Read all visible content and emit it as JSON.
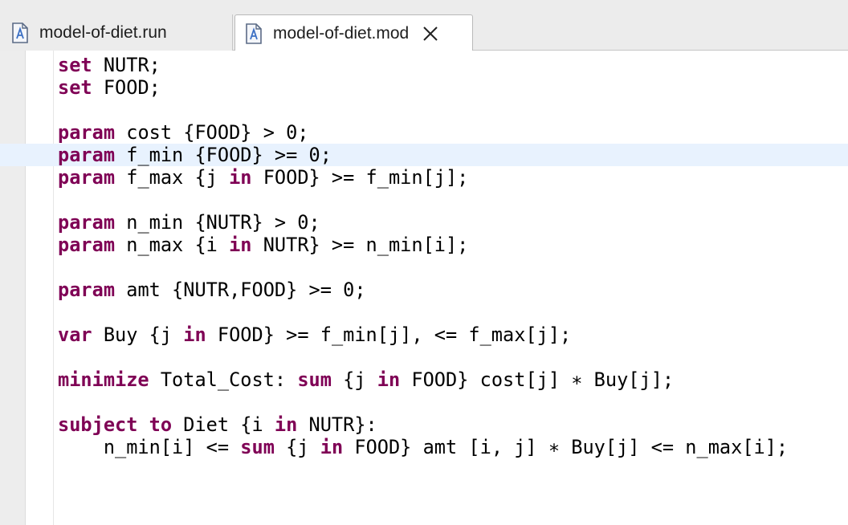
{
  "tabs": [
    {
      "label": "model-of-diet.run",
      "active": false,
      "icon": "ampl-file-icon"
    },
    {
      "label": "model-of-diet.mod",
      "active": true,
      "icon": "ampl-file-icon",
      "closable": true
    }
  ],
  "colors": {
    "keyword": "#7f0055",
    "text": "#000000",
    "current_line_highlight": "#e8f2fe",
    "tabbar_background": "#ececec",
    "gutter_background": "#ededed"
  },
  "editor": {
    "current_line_index": 4,
    "lines": [
      [
        {
          "k": true,
          "t": "set"
        },
        {
          "t": " NUTR;"
        }
      ],
      [
        {
          "k": true,
          "t": "set"
        },
        {
          "t": " FOOD;"
        }
      ],
      [],
      [
        {
          "k": true,
          "t": "param"
        },
        {
          "t": " cost {FOOD} > 0;"
        }
      ],
      [
        {
          "k": true,
          "t": "param"
        },
        {
          "t": " f_min {FOOD} >= 0;"
        }
      ],
      [
        {
          "k": true,
          "t": "param"
        },
        {
          "t": " f_max {j "
        },
        {
          "k": true,
          "t": "in"
        },
        {
          "t": " FOOD} >= f_min[j];"
        }
      ],
      [],
      [
        {
          "k": true,
          "t": "param"
        },
        {
          "t": " n_min {NUTR} > 0;"
        }
      ],
      [
        {
          "k": true,
          "t": "param"
        },
        {
          "t": " n_max {i "
        },
        {
          "k": true,
          "t": "in"
        },
        {
          "t": " NUTR} >= n_min[i];"
        }
      ],
      [],
      [
        {
          "k": true,
          "t": "param"
        },
        {
          "t": " amt {NUTR,FOOD} >= 0;"
        }
      ],
      [],
      [
        {
          "k": true,
          "t": "var"
        },
        {
          "t": " Buy {j "
        },
        {
          "k": true,
          "t": "in"
        },
        {
          "t": " FOOD} >= f_min[j], <= f_max[j];"
        }
      ],
      [],
      [
        {
          "k": true,
          "t": "minimize"
        },
        {
          "t": " Total_Cost: "
        },
        {
          "k": true,
          "t": "sum"
        },
        {
          "t": " {j "
        },
        {
          "k": true,
          "t": "in"
        },
        {
          "t": " FOOD} cost[j] ∗ Buy[j];"
        }
      ],
      [],
      [
        {
          "k": true,
          "t": "subject to"
        },
        {
          "t": " Diet {i "
        },
        {
          "k": true,
          "t": "in"
        },
        {
          "t": " NUTR}:"
        }
      ],
      [
        {
          "t": "    n_min[i] <= "
        },
        {
          "k": true,
          "t": "sum"
        },
        {
          "t": " {j "
        },
        {
          "k": true,
          "t": "in"
        },
        {
          "t": " FOOD} amt [i, j] ∗ Buy[j] <= n_max[i];"
        }
      ]
    ]
  }
}
